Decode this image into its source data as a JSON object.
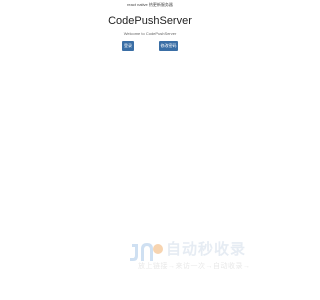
{
  "header": {
    "top_text": "react native 热更新服务器",
    "title": "CodePushServer",
    "subtitle": "Welcome to CodePushServer"
  },
  "actions": {
    "login_label": "登录",
    "change_password_label": "修改密码"
  },
  "watermark": {
    "brand": "自动秒收录",
    "tagline": "放上链接→来访一次→自动收录→",
    "colors": {
      "logo_blue": "#cfe0f2",
      "logo_orange": "#f7d4b0",
      "text_gray": "#e8e8e8"
    }
  },
  "colors": {
    "button_bg": "#3a6ea5",
    "button_text": "#ffffff",
    "page_bg": "#ffffff"
  }
}
